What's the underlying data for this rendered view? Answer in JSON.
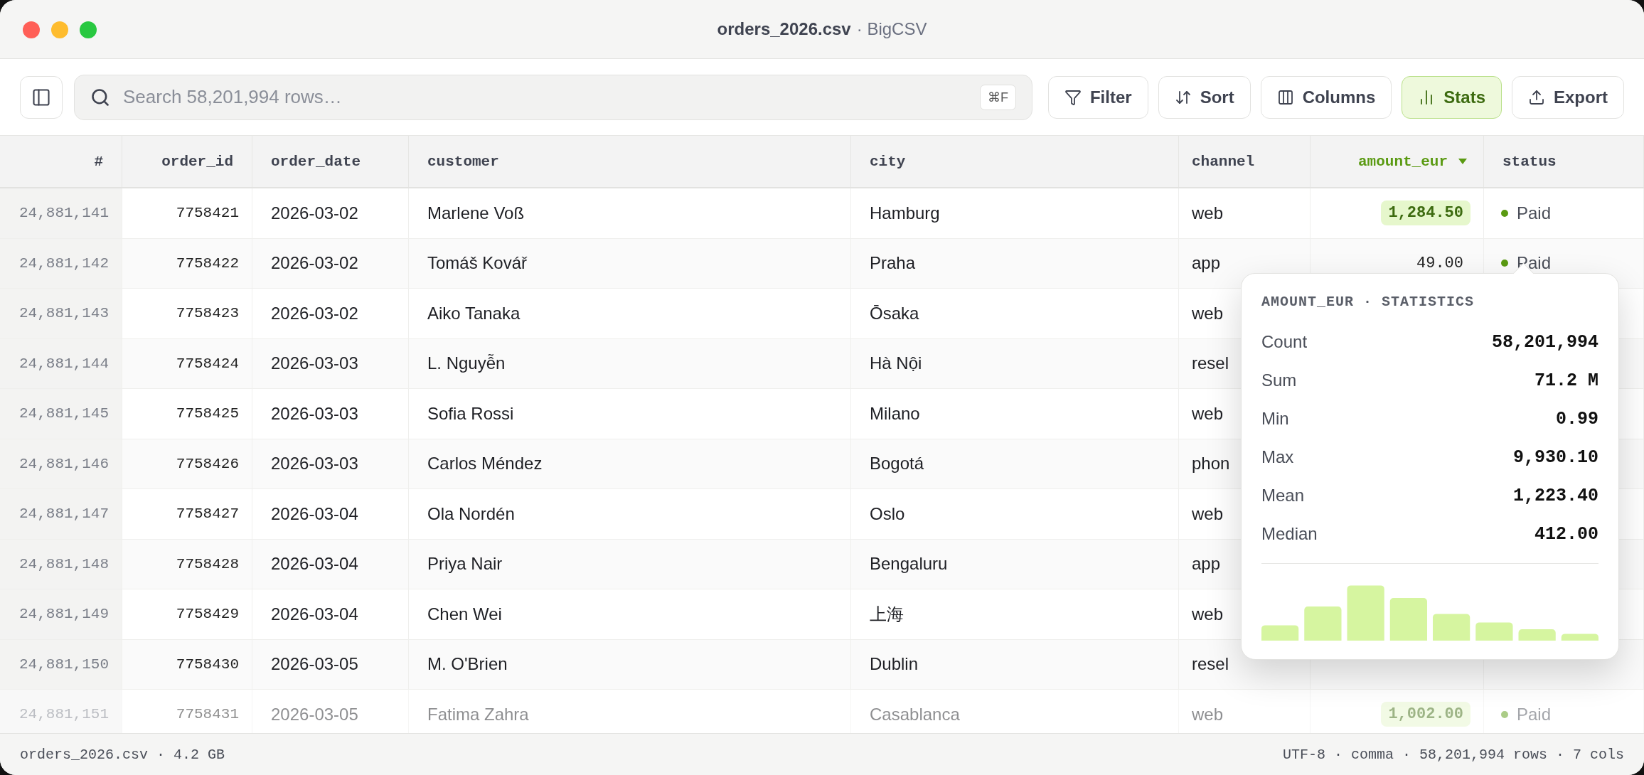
{
  "window": {
    "title": {
      "file": "orders_2026.csv",
      "app": "· BigCSV"
    }
  },
  "toolbar": {
    "search": {
      "placeholder": "Search 58,201,994 rows…",
      "shortcut": "⌘F"
    },
    "buttons": [
      {
        "label": "Filter",
        "selected": false
      },
      {
        "label": "Sort",
        "selected": false
      },
      {
        "label": "Columns",
        "selected": false
      },
      {
        "label": "Stats",
        "selected": true
      },
      {
        "label": "Export",
        "selected": false
      }
    ]
  },
  "table": {
    "columns": [
      {
        "label": "#",
        "sorted": false
      },
      {
        "label": "order_id",
        "sorted": false
      },
      {
        "label": "order_date",
        "sorted": false
      },
      {
        "label": "customer",
        "sorted": false
      },
      {
        "label": "city",
        "sorted": false
      },
      {
        "label": "channel",
        "sorted": false
      },
      {
        "label": "amount_eur",
        "sorted": true
      },
      {
        "label": "status",
        "sorted": false
      }
    ],
    "rows": [
      {
        "number": "24,881,141",
        "order_id": "7758421",
        "order_date": "2026-03-02",
        "customer": "Marlene Voß",
        "city": "Hamburg",
        "channel": "web",
        "amount": {
          "text": "1,284.50",
          "highlighted": true
        },
        "status": "Paid"
      },
      {
        "number": "24,881,142",
        "order_id": "7758422",
        "order_date": "2026-03-02",
        "customer": "Tomáš Kovář",
        "city": "Praha",
        "channel": "app",
        "amount": {
          "text": "49.00",
          "highlighted": false
        },
        "status": "Paid"
      },
      {
        "number": "24,881,143",
        "order_id": "7758423",
        "order_date": "2026-03-02",
        "customer": "Aiko Tanaka",
        "city": "Ōsaka",
        "channel": "web"
      },
      {
        "number": "24,881,144",
        "order_id": "7758424",
        "order_date": "2026-03-03",
        "customer": "L. Nguyễn",
        "city": "Hà Nội",
        "channel": "resel"
      },
      {
        "number": "24,881,145",
        "order_id": "7758425",
        "order_date": "2026-03-03",
        "customer": "Sofia Rossi",
        "city": "Milano",
        "channel": "web"
      },
      {
        "number": "24,881,146",
        "order_id": "7758426",
        "order_date": "2026-03-03",
        "customer": "Carlos Méndez",
        "city": "Bogotá",
        "channel": "phon"
      },
      {
        "number": "24,881,147",
        "order_id": "7758427",
        "order_date": "2026-03-04",
        "customer": "Ola Nordén",
        "city": "Oslo",
        "channel": "web"
      },
      {
        "number": "24,881,148",
        "order_id": "7758428",
        "order_date": "2026-03-04",
        "customer": "Priya Nair",
        "city": "Bengaluru",
        "channel": "app"
      },
      {
        "number": "24,881,149",
        "order_id": "7758429",
        "order_date": "2026-03-04",
        "customer": "Chen Wei",
        "city": "上海",
        "channel": "web"
      },
      {
        "number": "24,881,150",
        "order_id": "7758430",
        "order_date": "2026-03-05",
        "customer": "M. O'Brien",
        "city": "Dublin",
        "channel": "resel"
      },
      {
        "number": "24,881,151",
        "order_id": "7758431",
        "order_date": "2026-03-05",
        "customer": "Fatima Zahra",
        "city": "Casablanca",
        "channel": "web",
        "amount": {
          "text": "1,002.00",
          "highlighted": true
        },
        "status": "Paid"
      }
    ]
  },
  "stats_popover": {
    "title": "AMOUNT_EUR · STATISTICS",
    "rows": [
      {
        "label": "Count",
        "value": "58,201,994"
      },
      {
        "label": "Sum",
        "value": "71.2 M"
      },
      {
        "label": "Min",
        "value": "0.99"
      },
      {
        "label": "Max",
        "value": "9,930.10"
      },
      {
        "label": "Mean",
        "value": "1,223.40"
      },
      {
        "label": "Median",
        "value": "412.00"
      }
    ]
  },
  "status_bar": {
    "left": "orders_2026.csv · 4.2 GB",
    "right": "UTF-8 · comma · 58,201,994 rows · 7 cols"
  }
}
